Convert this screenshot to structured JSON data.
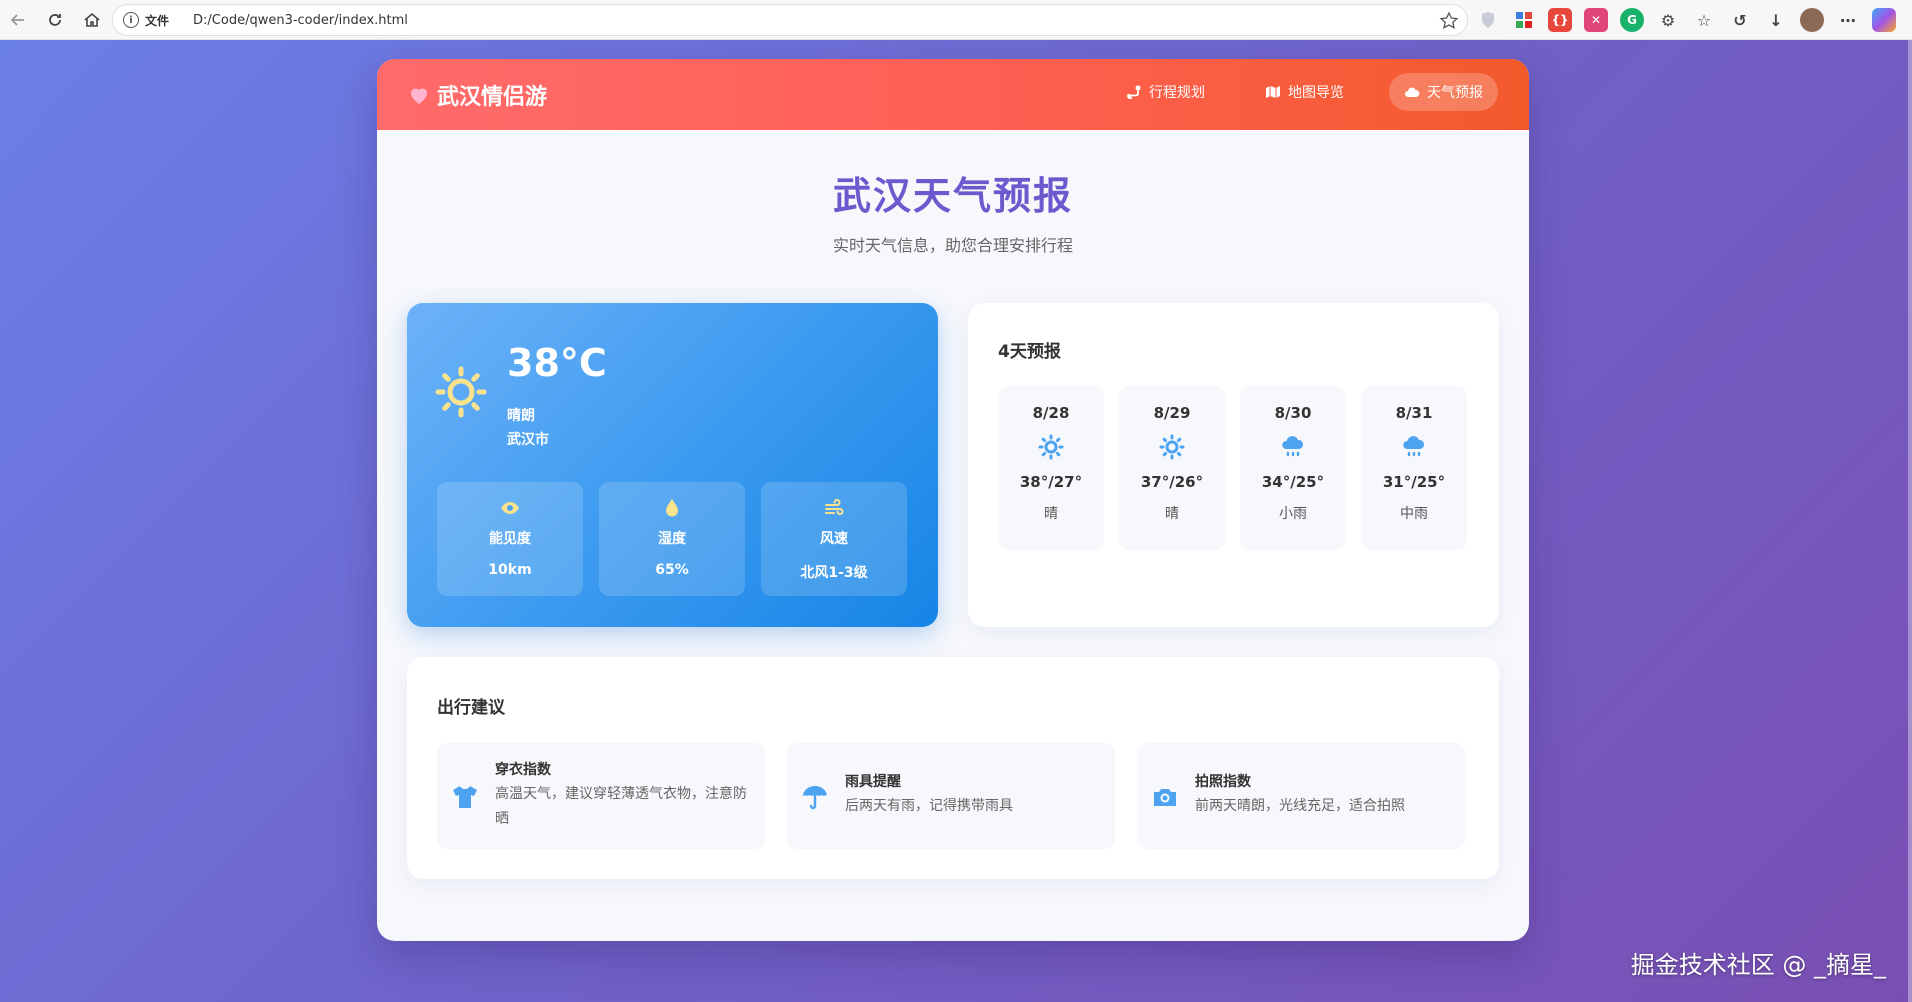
{
  "browser": {
    "file_label": "文件",
    "url": "D:/Code/qwen3-coder/index.html"
  },
  "app": {
    "logo": "武汉情侣游",
    "nav": [
      {
        "label": "行程规划",
        "icon": "route-icon"
      },
      {
        "label": "地图导览",
        "icon": "map-icon"
      },
      {
        "label": "天气预报",
        "icon": "cloud-icon",
        "active": true
      }
    ],
    "title": "武汉天气预报",
    "subtitle": "实时天气信息，助您合理安排行程"
  },
  "current": {
    "temperature": "38°C",
    "condition": "晴朗",
    "city": "武汉市",
    "metrics": [
      {
        "label": "能见度",
        "value": "10km",
        "icon": "eye-icon"
      },
      {
        "label": "湿度",
        "value": "65%",
        "icon": "droplet-icon"
      },
      {
        "label": "风速",
        "value": "北风1-3级",
        "icon": "wind-icon"
      }
    ]
  },
  "forecast": {
    "title": "4天预报",
    "days": [
      {
        "date": "8/28",
        "temp": "38°/27°",
        "cond": "晴",
        "icon": "sun-icon"
      },
      {
        "date": "8/29",
        "temp": "37°/26°",
        "cond": "晴",
        "icon": "sun-icon"
      },
      {
        "date": "8/30",
        "temp": "34°/25°",
        "cond": "小雨",
        "icon": "rain-cloud-icon"
      },
      {
        "date": "8/31",
        "temp": "31°/25°",
        "cond": "中雨",
        "icon": "rain-cloud-icon"
      }
    ]
  },
  "advice": {
    "title": "出行建议",
    "tips": [
      {
        "title": "穿衣指数",
        "desc": "高温天气，建议穿轻薄透气衣物，注意防晒",
        "icon": "tshirt-icon"
      },
      {
        "title": "雨具提醒",
        "desc": "后两天有雨，记得携带雨具",
        "icon": "umbrella-icon"
      },
      {
        "title": "拍照指数",
        "desc": "前两天晴朗，光线充足，适合拍照",
        "icon": "camera-icon"
      }
    ]
  },
  "colors": {
    "accent": "#6a5acd",
    "header_start": "#ff6b6b",
    "header_end": "#f25a2b",
    "weather_card": "#3d9bf0",
    "icon_blue": "#4da3f0",
    "sun_yellow": "#fbe38e"
  },
  "watermark": "掘金技术社区 @ _摘星_"
}
